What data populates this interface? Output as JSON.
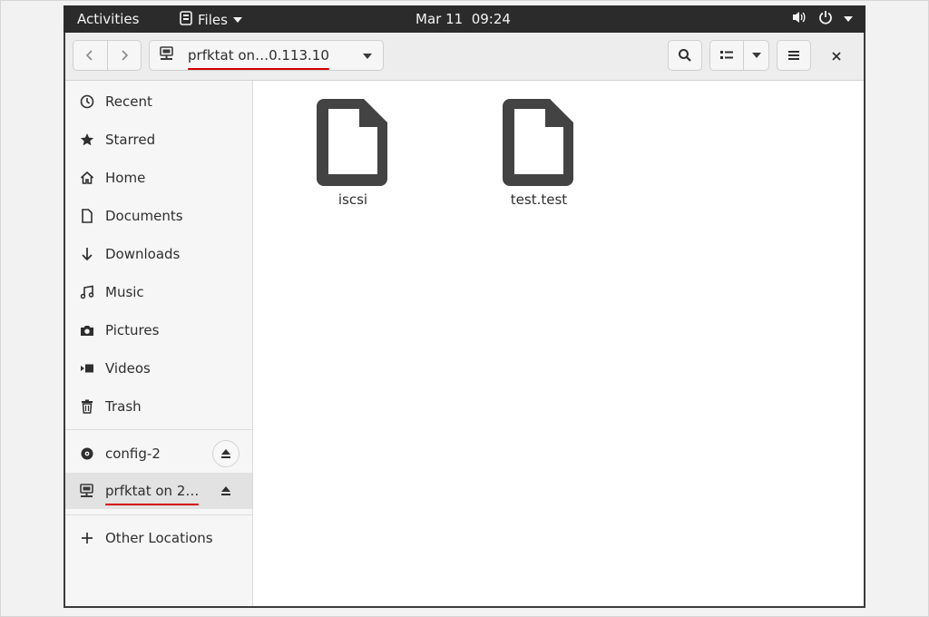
{
  "topbar": {
    "activities": "Activities",
    "app_name": "Files",
    "clock": "Mar 11  09:24",
    "icons": [
      "volume-icon",
      "power-icon",
      "system-menu-chevron-icon"
    ]
  },
  "headerbar": {
    "back_icon": "chevron-left-icon",
    "forward_icon": "chevron-right-icon",
    "path_label": "prfktat on…0.113.10",
    "path_icon": "network-server-icon",
    "search_icon": "search-icon",
    "view_icon": "list-view-icon",
    "menu_icon": "hamburger-menu-icon",
    "close_icon": "close-icon"
  },
  "sidebar": {
    "places": [
      {
        "label": "Recent",
        "icon": "clock-icon"
      },
      {
        "label": "Starred",
        "icon": "star-icon"
      },
      {
        "label": "Home",
        "icon": "home-icon"
      },
      {
        "label": "Documents",
        "icon": "document-icon"
      },
      {
        "label": "Downloads",
        "icon": "download-icon"
      },
      {
        "label": "Music",
        "icon": "music-icon"
      },
      {
        "label": "Pictures",
        "icon": "camera-icon"
      },
      {
        "label": "Videos",
        "icon": "video-icon"
      },
      {
        "label": "Trash",
        "icon": "trash-icon"
      }
    ],
    "devices": [
      {
        "label": "config-2",
        "icon": "disc-icon"
      },
      {
        "label": "prfktat on 2…",
        "icon": "network-server-icon",
        "selected": true
      }
    ],
    "other": {
      "label": "Other Locations",
      "icon": "plus-icon"
    }
  },
  "files": [
    {
      "name": "iscsi",
      "icon": "file-icon"
    },
    {
      "name": "test.test",
      "icon": "file-icon"
    }
  ],
  "colors": {
    "topbar_bg": "#2b2b2b",
    "annotation_red": "#d40000",
    "selected_bg": "#e2e2e2"
  }
}
